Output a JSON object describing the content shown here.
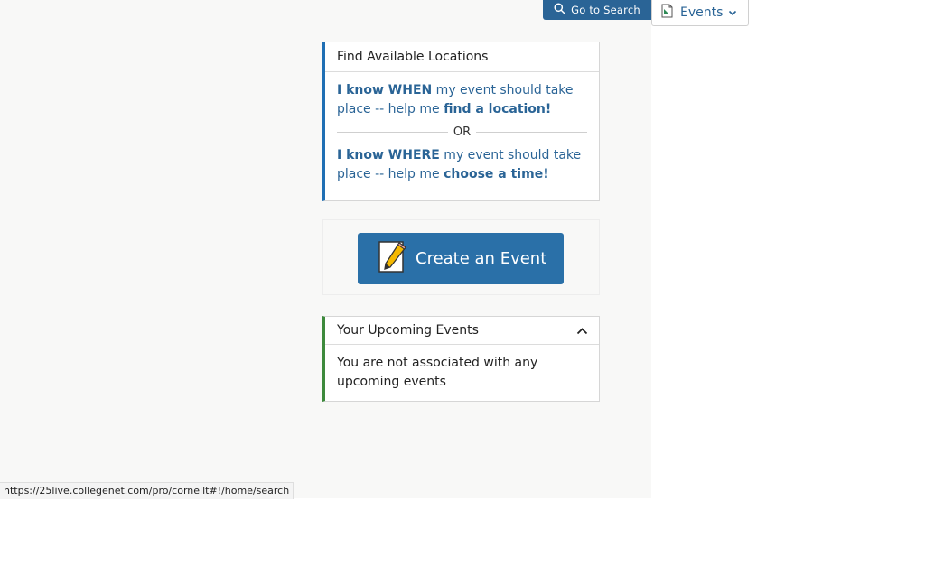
{
  "topbar": {
    "go_search_label": "Go to Search",
    "search_icon": "search-icon",
    "events_label": "Events",
    "events_icon": "events-doc-icon"
  },
  "find_card": {
    "title": "Find Available Locations",
    "when_bold": "I know WHEN",
    "when_mid": " my event should take place -- help me ",
    "when_tail": "find a location!",
    "or_label": "OR",
    "where_bold": "I know WHERE",
    "where_mid": " my event should take place -- help me ",
    "where_tail": "choose a time!",
    "accent_color": "#1f6fb4"
  },
  "create": {
    "label": "Create an Event",
    "icon": "notepad-pencil-icon",
    "color": "#2a70a8"
  },
  "upcoming_card": {
    "title": "Your Upcoming Events",
    "empty_text": "You are not associated with any upcoming events",
    "accent_color": "#3d8a3c"
  },
  "status_bar": {
    "url": "https://25live.collegenet.com/pro/cornellt#!/home/search"
  }
}
